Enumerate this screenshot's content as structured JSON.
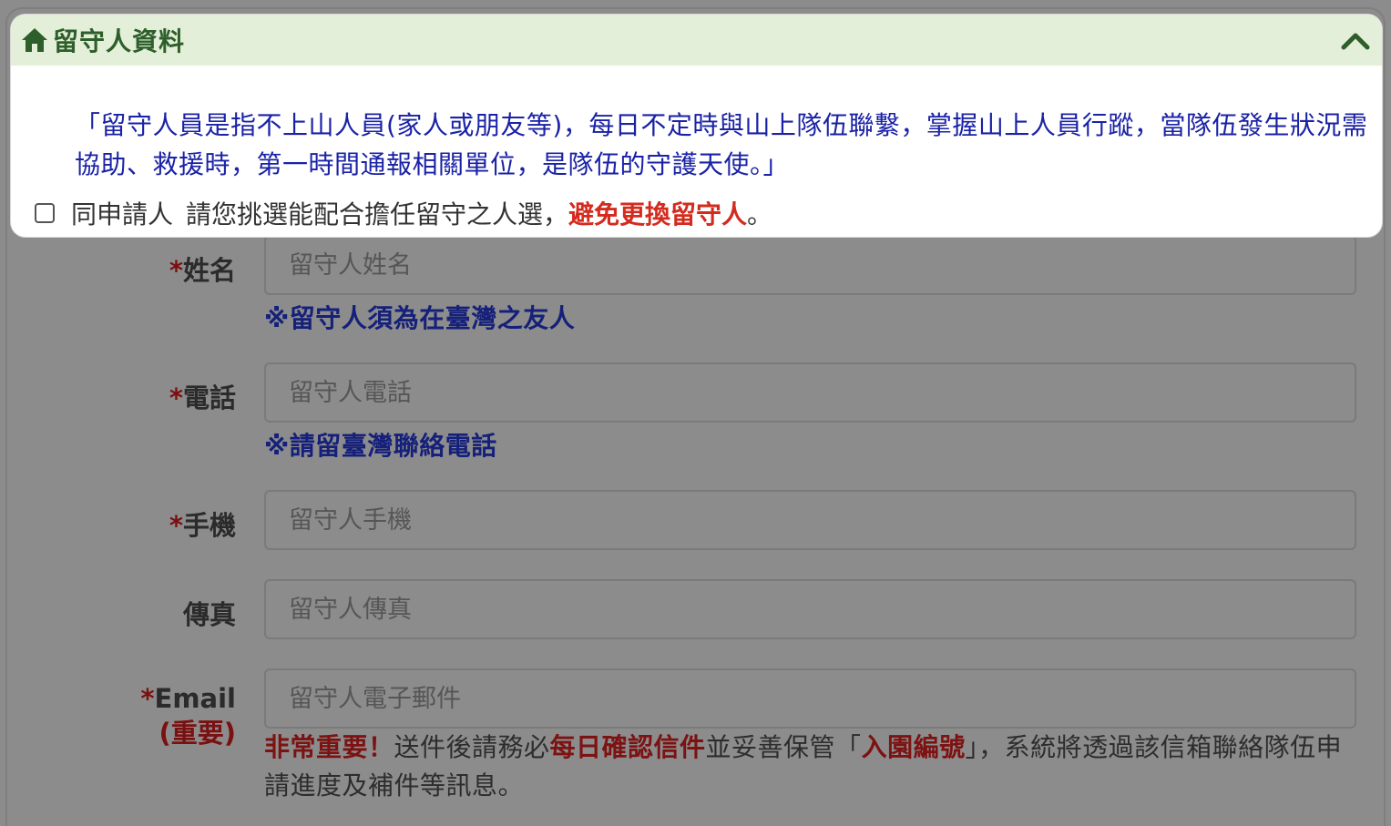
{
  "panel": {
    "title": "留守人資料",
    "quote": "「留守人員是指不上山人員(家人或朋友等)，每日不定時與山上隊伍聯繫，掌握山上人員行蹤，當隊伍發生狀況需協助、救援時，第一時間通報相關單位，是隊伍的守護天使。」",
    "same_as_applicant": "同申請人",
    "instruction_prefix": "請您挑選能配合擔任留守之人選，",
    "instruction_warning": "避免更換留守人",
    "instruction_suffix": "。"
  },
  "form": {
    "required_mark": "*",
    "name": {
      "label": "姓名",
      "placeholder": "留守人姓名",
      "hint": "※留守人須為在臺灣之友人"
    },
    "phone": {
      "label": "電話",
      "placeholder": "留守人電話",
      "hint": "※請留臺灣聯絡電話"
    },
    "mobile": {
      "label": "手機",
      "placeholder": "留守人手機"
    },
    "fax": {
      "label": "傳真",
      "placeholder": "留守人傳真"
    },
    "email": {
      "label": "Email",
      "sublabel": "(重要)",
      "placeholder": "留守人電子郵件",
      "note_important": "非常重要！",
      "note_part1": "送件後請務必",
      "note_daily": "每日確認信件",
      "note_part2": "並妥善保管「",
      "note_park_no": "入園編號",
      "note_part3": "」，系統將透過該信箱聯絡隊伍申請進度及補件等訊息。"
    }
  },
  "colors": {
    "header_bg": "#e3efd9",
    "title_green": "#2e5e2a",
    "quote_blue": "#1a22a6",
    "warning_red": "#d42b1e",
    "overlay_gray": "#8c8c8c"
  }
}
